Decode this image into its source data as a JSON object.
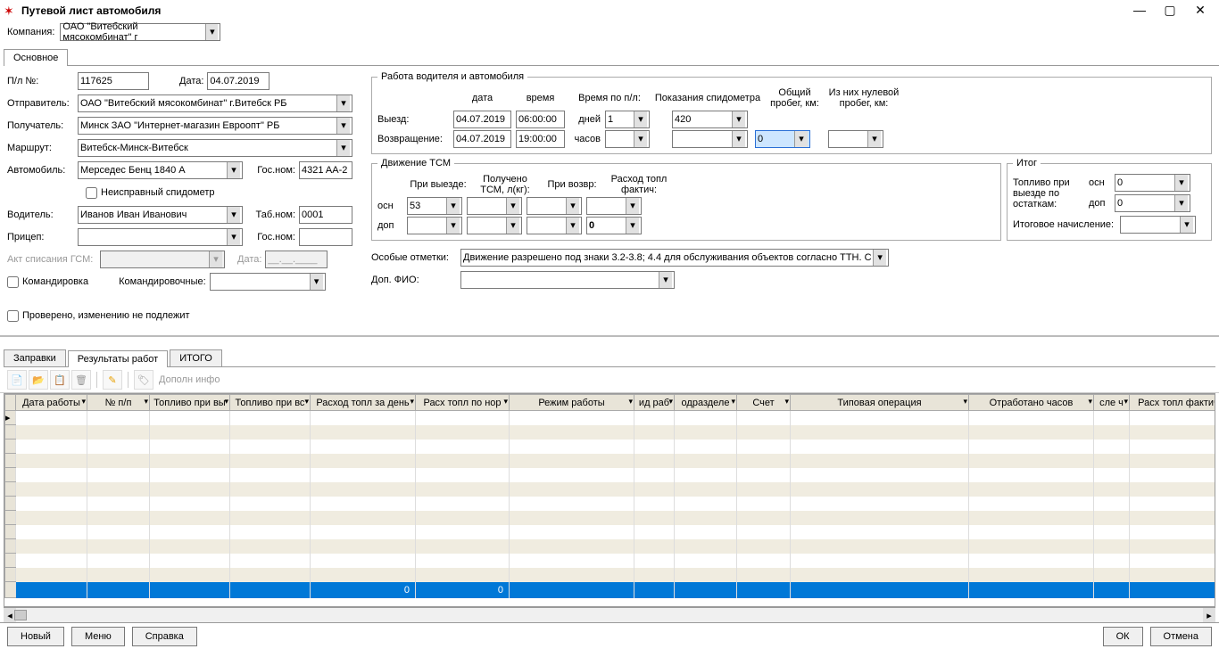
{
  "window": {
    "title": "Путевой лист автомобиля"
  },
  "company": {
    "label": "Компания:",
    "value": "ОАО \"Витебский мясокомбинат\" г"
  },
  "mainTab": "Основное",
  "form": {
    "plno_label": "П/л №:",
    "plno": "117625",
    "date_label": "Дата:",
    "date": "04.07.2019",
    "sender_label": "Отправитель:",
    "sender": "ОАО \"Витебский мясокомбинат\" г.Витебск РБ",
    "receiver_label": "Получатель:",
    "receiver": "Минск ЗАО \"Интернет-магазин Евроопт\" РБ",
    "route_label": "Маршрут:",
    "route": "Витебск-Минск-Витебск",
    "auto_label": "Автомобиль:",
    "auto": "Мерседес Бенц 1840 А",
    "gosnom_label": "Гос.ном:",
    "gosnom": "4321 AA-2",
    "bad_spido": "Неисправный спидометр",
    "driver_label": "Водитель:",
    "driver": "Иванов Иван Иванович",
    "tabnom_label": "Таб.ном:",
    "tabnom": "0001",
    "trailer_label": "Прицеп:",
    "trailer": "",
    "trailer_gos_label": "Гос.ном:",
    "trailer_gos": "",
    "act_label": "Акт списания ГСМ:",
    "act": "",
    "act_date_label": "Дата:",
    "act_date": "__.__.____",
    "trip_label": "Командировка",
    "travel_exp_label": "Командировочные:",
    "checked_label": "Проверено, изменению не подлежит"
  },
  "work": {
    "legend": "Работа водителя и автомобиля",
    "h_date": "дата",
    "h_time": "время",
    "h_timepl": "Время по п/л:",
    "h_spido": "Показания спидометра",
    "h_total": "Общий пробег, км:",
    "h_zero": "Из них нулевой пробег, км:",
    "out_label": "Выезд:",
    "out_date": "04.07.2019",
    "out_time": "06:00:00",
    "days_label": "дней",
    "days": "1",
    "spido_out": "420",
    "ret_label": "Возвращение:",
    "ret_date": "04.07.2019",
    "ret_time": "19:00:00",
    "hours_label": "часов",
    "hours": "",
    "spido_ret": "",
    "total_km": "0",
    "zero_km": ""
  },
  "tcm": {
    "legend": "Движение ТСМ",
    "h_out": "При выезде:",
    "h_recv": "Получено ТСМ, л(кг):",
    "h_ret": "При возвр:",
    "h_fact": "Расход топл фактич:",
    "osn_label": "осн",
    "osn_out": "53",
    "osn_recv": "",
    "osn_ret": "",
    "osn_fact": "",
    "dop_label": "доп",
    "dop_out": "",
    "dop_recv": "",
    "dop_ret": "",
    "dop_fact": "0"
  },
  "itog": {
    "legend": "Итог",
    "fuel_out_label": "Топливо при выезде по остаткам:",
    "osn_label": "осн",
    "osn": "0",
    "dop_label": "доп",
    "dop": "0",
    "final_label": "Итоговое начисление:",
    "final": ""
  },
  "notes": {
    "special_label": "Особые отметки:",
    "special": "Движение разрешено под знаки 3.2-3.8; 4.4 для обслуживания объектов согласно ТТН. С м",
    "dopfio_label": "Доп. ФИО:",
    "dopfio": ""
  },
  "bottomTabs": {
    "t1": "Заправки",
    "t2": "Результаты работ",
    "t3": "ИТОГО"
  },
  "toolbar": {
    "extra": "Дополн инфо"
  },
  "grid": {
    "cols": [
      "Дата работы",
      "№ п/п",
      "Топливо при вы",
      "Топливо при вс",
      "Расход топл за день",
      "Расх топл по нор",
      "Режим работы",
      "ид раб",
      "одразделе",
      "Счет",
      "Типовая операция",
      "Отработано часов",
      "сле ч",
      "Расх топл фактич"
    ],
    "totals": [
      "",
      "",
      "",
      "",
      "0",
      "0",
      "",
      "",
      "",
      "",
      "",
      "",
      "",
      ""
    ]
  },
  "footer": {
    "new": "Новый",
    "menu": "Меню",
    "help": "Справка",
    "ok": "ОК",
    "cancel": "Отмена"
  }
}
